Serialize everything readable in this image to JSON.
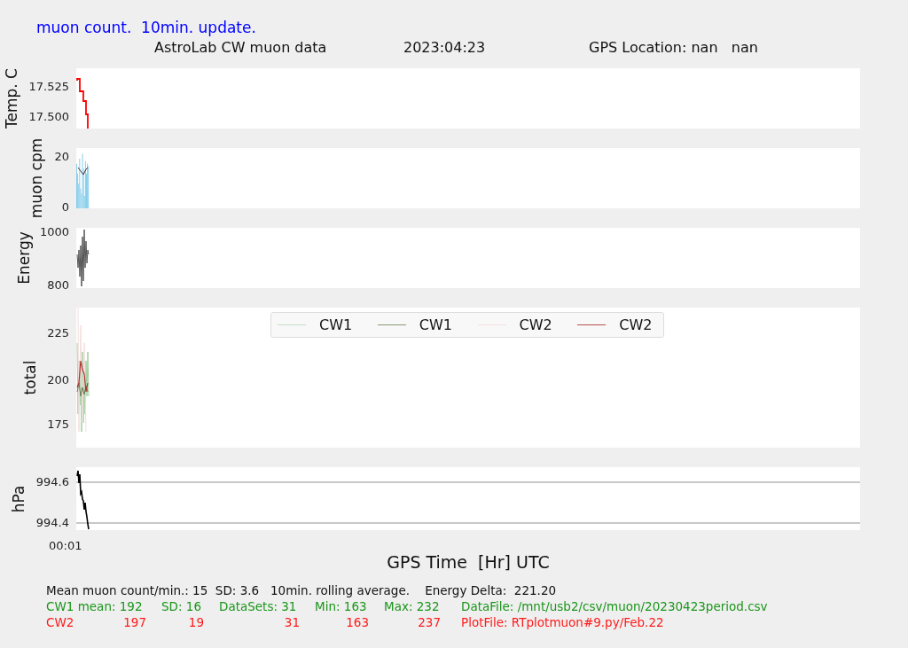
{
  "header": {
    "title": "muon count.  10min. update.",
    "subtitle": [
      "AstroLab CW muon data",
      "2023:04:23",
      "GPS Location: nan   nan"
    ]
  },
  "panels": [
    {
      "kind": "temp",
      "ylabel": "Temp. C",
      "yticks": [
        "17.525",
        "17.500"
      ]
    },
    {
      "kind": "cpm",
      "ylabel": "muon cpm",
      "yticks": [
        "20",
        "0"
      ]
    },
    {
      "kind": "energy",
      "ylabel": "Energy",
      "yticks": [
        "1000",
        "800"
      ]
    },
    {
      "kind": "total",
      "ylabel": "total",
      "yticks": [
        "225",
        "200",
        "175"
      ],
      "legend": [
        {
          "label": "CW1",
          "color": "#c8dcc8"
        },
        {
          "label": "CW1",
          "color": "#8a9a78"
        },
        {
          "label": "CW2",
          "color": "#f4dede"
        },
        {
          "label": "CW2",
          "color": "#c05050"
        }
      ]
    },
    {
      "kind": "pressure",
      "ylabel": "hPa",
      "yticks": [
        "994.6",
        "994.4"
      ]
    }
  ],
  "xtick": "00:01",
  "xlabel": "GPS Time  [Hr] UTC",
  "footer": {
    "summary": "Mean muon count/min.: 15  SD: 3.6   10min. rolling average.    Energy Delta:  221.20",
    "rows": [
      {
        "kind": "labels",
        "color": "#1a961a",
        "cells": [
          "CW1 mean: 192",
          "SD: 16",
          "DataSets: 31",
          "Min: 163",
          "Max: 232",
          "DataFile: /mnt/usb2/csv/muon/20230423period.csv"
        ]
      },
      {
        "kind": "values",
        "color": "#ff1a1a",
        "label": "CW2",
        "cells": [
          "197",
          "19",
          "31",
          "163",
          "237",
          "PlotFile: RTplotmuon#9.py/Feb.22"
        ]
      }
    ]
  }
}
